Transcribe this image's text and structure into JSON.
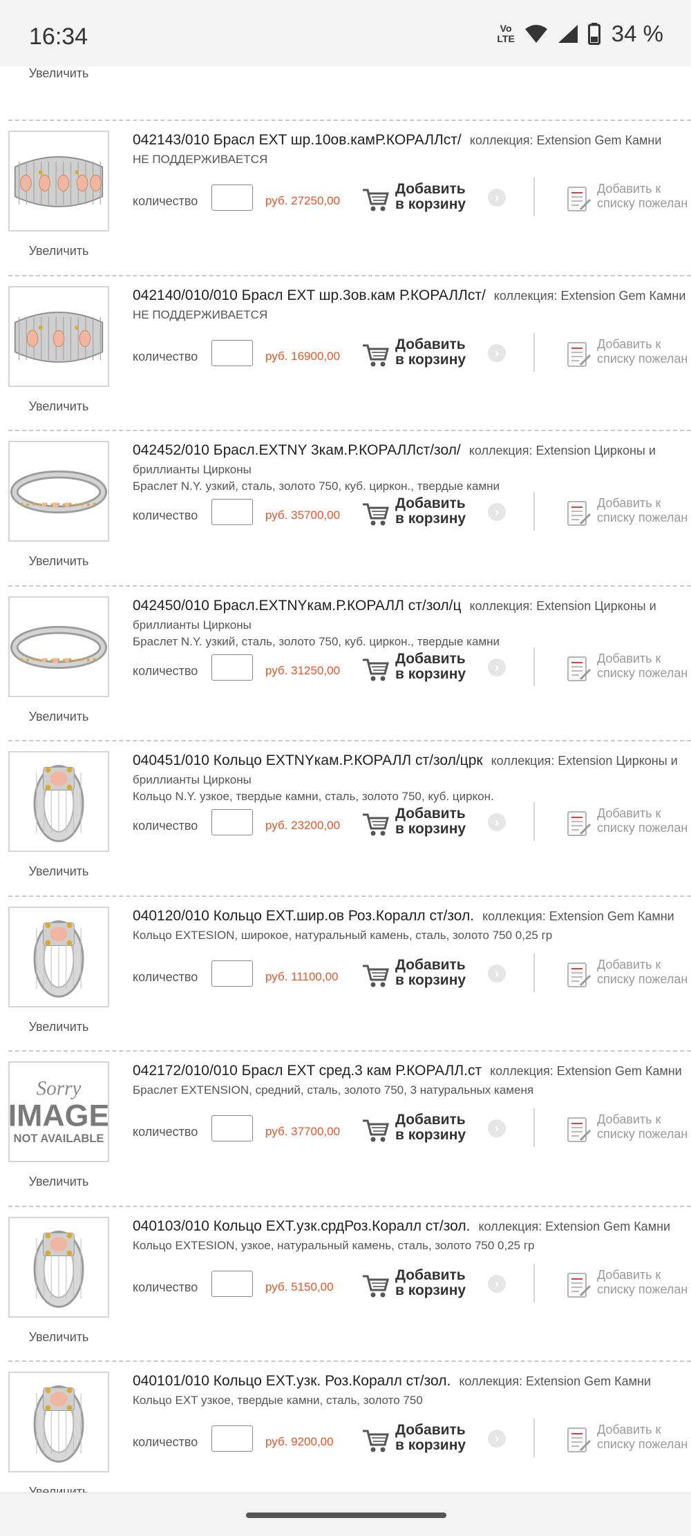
{
  "status_bar": {
    "time": "16:34",
    "network_line1": "Vo",
    "network_line2": "LTE",
    "battery": "34 %"
  },
  "ui": {
    "enlarge": "Увеличить",
    "qty_label": "количество",
    "cart_line1": "Добавить",
    "cart_line2": "в корзину",
    "wish_line1": "Добавить к",
    "wish_line2": "списку пожелан"
  },
  "top_item": {
    "enlarge": "Увеличить"
  },
  "items": [
    {
      "title": "042143/010 Брасл EXT шр.10ов.камР.КОРАЛЛст/",
      "collection": "коллекция: Extension Gem Камни",
      "line2": "НЕ ПОДДЕРЖИВАЕТСЯ",
      "desc": "",
      "price": "руб. 27250,00",
      "image": "wide-bracelet"
    },
    {
      "title": "042140/010/010 Брасл EXT шр.3ов.кам Р.КОРАЛЛст/",
      "collection": "коллекция: Extension Gem Камни",
      "line2": "НЕ ПОДДЕРЖИВАЕТСЯ",
      "desc": "",
      "price": "руб. 16900,00",
      "image": "wide-bracelet"
    },
    {
      "title": "042452/010 Брасл.EXTNY 3кам.Р.КОРАЛЛст/зол/",
      "collection": "коллекция: Extension Цирконы и",
      "line2": "бриллианты Цирконы",
      "desc": "Браслет N.Y. узкий, сталь, золото 750, куб. циркон., твердые камни",
      "price": "руб. 35700,00",
      "image": "narrow-bracelet"
    },
    {
      "title": "042450/010 Брасл.EXTNYкам.Р.КОРАЛЛ ст/зол/ц",
      "collection": "коллекция: Extension Цирконы и",
      "line2": "бриллианты Цирконы",
      "desc": "Браслет N.Y. узкий, сталь, золото 750, куб. циркон., твердые камни",
      "price": "руб. 31250,00",
      "image": "narrow-bracelet"
    },
    {
      "title": "040451/010 Кольцо EXTNYкам.Р.КОРАЛЛ ст/зол/црк",
      "collection": "коллекция: Extension Цирконы и",
      "line2": "бриллианты Цирконы",
      "desc": "Кольцо N.Y. узкое, твердые камни, сталь, золото 750, куб. циркон.",
      "price": "руб. 23200,00",
      "image": "ring"
    },
    {
      "title": "040120/010 Кольцо EXT.шир.ов Роз.Коралл ст/зол.",
      "collection": "коллекция: Extension Gem Камни",
      "line2": "",
      "desc": "Кольцо EXTESION, широкое, натуральный камень, сталь, золото 750 0,25 гр",
      "price": "руб. 11100,00",
      "image": "ring"
    },
    {
      "title": "042172/010/010 Брасл EXT сред.3 кам Р.КОРАЛЛ.ст",
      "collection": "коллекция: Extension Gem Камни",
      "line2": "",
      "desc": "Браслет EXTENSION, средний, сталь, золото 750, 3 натуральных каменя",
      "price": "руб. 37700,00",
      "image": "placeholder"
    },
    {
      "title": "040103/010 Кольцо EXT.узк.срдРоз.Коралл ст/зол.",
      "collection": "коллекция: Extension Gem Камни",
      "line2": "",
      "desc": "Кольцо EXTESION, узкое, натуральный камень, сталь, золото 750 0,25 гр",
      "price": "руб. 5150,00",
      "image": "ring"
    },
    {
      "title": "040101/010 Кольцо EXT.узк. Роз.Коралл ст/зол.",
      "collection": "коллекция: Extension Gem Камни",
      "line2": "",
      "desc": "Кольцо EXT узкое, твердые камни, сталь, золото 750",
      "price": "руб. 9200,00",
      "image": "ring"
    }
  ],
  "placeholder_image": {
    "line1": "Sorry",
    "line2": "IMAGE",
    "line3": "NOT AVAILABLE"
  },
  "colors": {
    "price": "#e8552a",
    "separator": "#c8c8c8"
  }
}
